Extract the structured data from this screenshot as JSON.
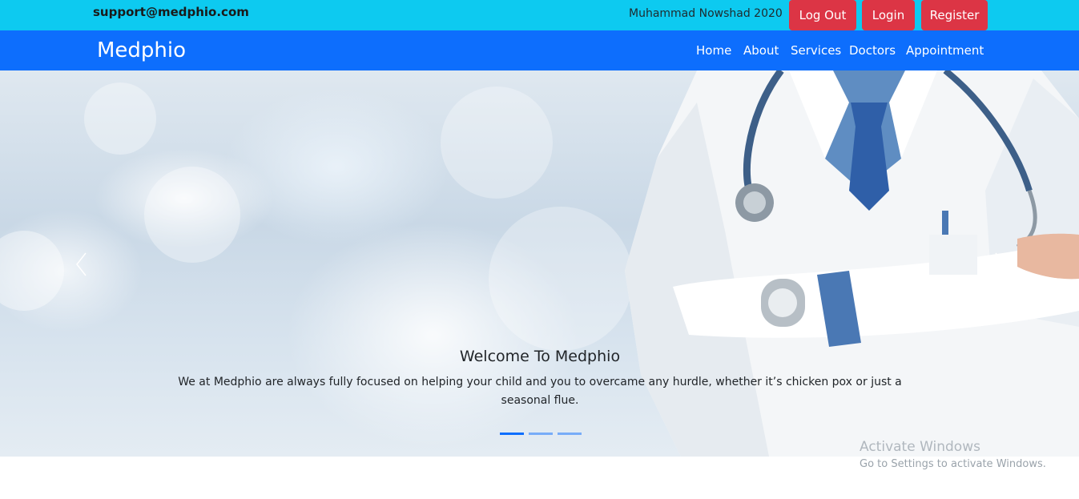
{
  "topbar": {
    "email": "support@medphio.com",
    "user": "Muhammad Nowshad 2020",
    "logout_label": "Log Out",
    "login_label": "Login",
    "register_label": "Register"
  },
  "navbar": {
    "brand": "Medphio",
    "links": [
      "Home",
      "About",
      "Services",
      "Doctors",
      "Appointment"
    ]
  },
  "carousel": {
    "title": "Welcome To Medphio",
    "text": "We at Medphio are always fully focused on helping your child and you to overcame any hurdle, whether it’s chicken pox or just a seasonal flue.",
    "slide_count": 3,
    "active_index": 0,
    "prev_icon": "chevron-left-icon",
    "next_icon": "chevron-right-icon"
  },
  "watermark": {
    "title": "Activate Windows",
    "subtitle": "Go to Settings to activate Windows."
  },
  "colors": {
    "topbar": "#0dcaf0",
    "navbar": "#0d6efd",
    "button": "#dc3545"
  }
}
